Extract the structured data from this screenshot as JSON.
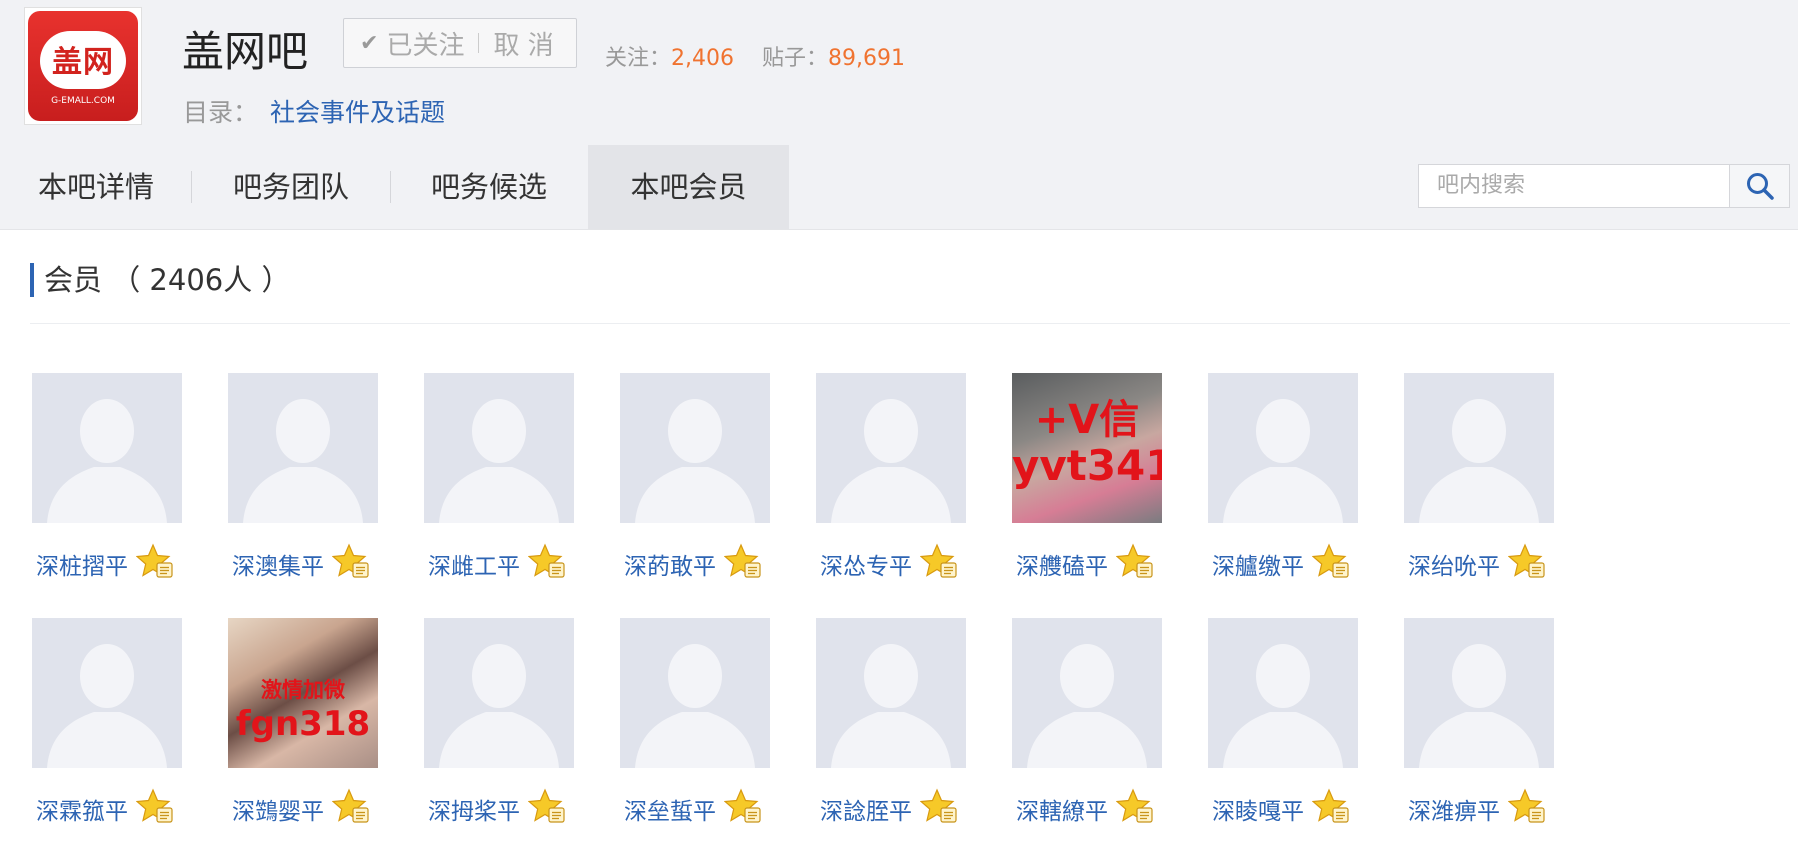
{
  "header": {
    "logo_text": "盖网",
    "logo_sub": "G-EMALL.COM",
    "bar_name": "盖网吧",
    "follow_label": "已关注",
    "unfollow_label": "取 消",
    "stats": {
      "follow_label": "关注：",
      "follow_count": "2,406",
      "posts_label": "贴子：",
      "posts_count": "89,691"
    },
    "catalog_label": "目录：",
    "catalog_value": "社会事件及话题"
  },
  "tabs": [
    {
      "label": "本吧详情",
      "active": false
    },
    {
      "label": "吧务团队",
      "active": false
    },
    {
      "label": "吧务候选",
      "active": false
    },
    {
      "label": "本吧会员",
      "active": true
    }
  ],
  "search": {
    "placeholder": "吧内搜索"
  },
  "section": {
    "title": "会员 （ 2406人 ）"
  },
  "colors": {
    "accent": "#2d64b3",
    "stat_number": "#f07330",
    "avatar_bg": "#e0e3ec"
  },
  "members": [
    {
      "name": "深桩摺平",
      "avatar": "default"
    },
    {
      "name": "深澳集平",
      "avatar": "default"
    },
    {
      "name": "深雌工平",
      "avatar": "default"
    },
    {
      "name": "深菂敢平",
      "avatar": "default"
    },
    {
      "name": "深怂专平",
      "avatar": "default"
    },
    {
      "name": "深艭磕平",
      "avatar": "photo",
      "photo_text": [
        "+V信",
        "yvt341"
      ]
    },
    {
      "name": "深艫缴平",
      "avatar": "default"
    },
    {
      "name": "深绐吮平",
      "avatar": "default"
    },
    {
      "name": "深霖箛平",
      "avatar": "default"
    },
    {
      "name": "深鷑婴平",
      "avatar": "photo",
      "photo_text": [
        "激情加微",
        "fgn318"
      ]
    },
    {
      "name": "深拇桨平",
      "avatar": "default"
    },
    {
      "name": "深垒蜇平",
      "avatar": "default"
    },
    {
      "name": "深諗胵平",
      "avatar": "default"
    },
    {
      "name": "深轄繚平",
      "avatar": "default"
    },
    {
      "name": "深睖嘎平",
      "avatar": "default"
    },
    {
      "name": "深潍痹平",
      "avatar": "default"
    }
  ]
}
